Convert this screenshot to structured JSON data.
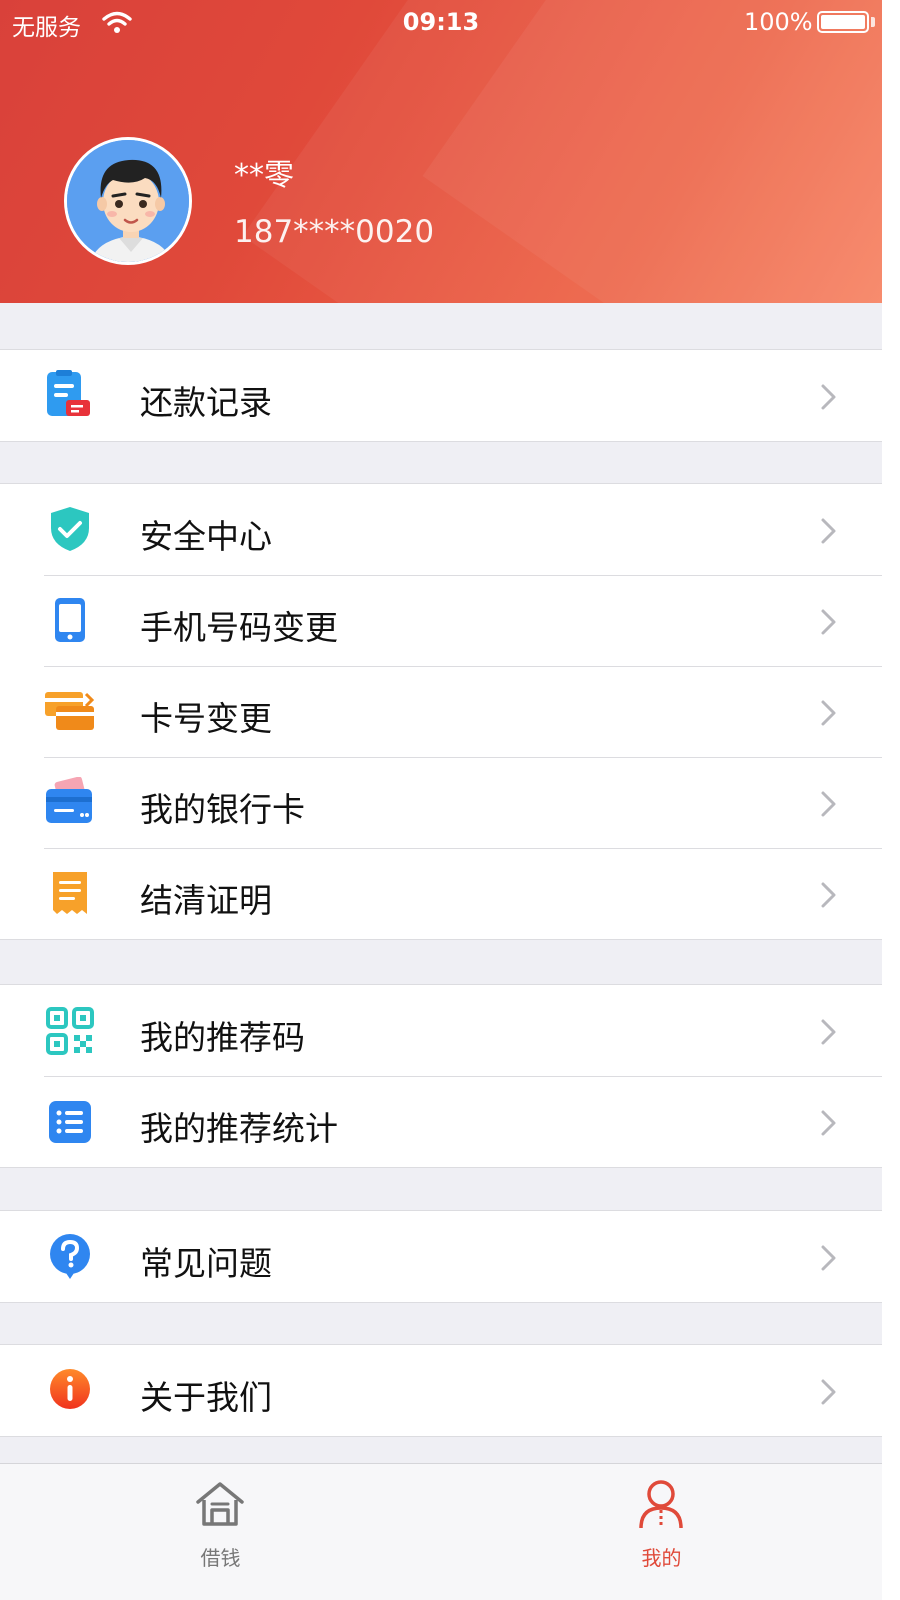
{
  "status_bar": {
    "carrier": "无服务",
    "time": "09:13",
    "battery": "100%"
  },
  "profile": {
    "name": "**零",
    "phone": "187****0020"
  },
  "menu": {
    "repay_record": "还款记录",
    "security_center": "安全中心",
    "phone_change": "手机号码变更",
    "card_change": "卡号变更",
    "my_bank_card": "我的银行卡",
    "settlement_proof": "结清证明",
    "referral_code": "我的推荐码",
    "referral_stats": "我的推荐统计",
    "faq": "常见问题",
    "about_us": "关于我们"
  },
  "tabs": {
    "borrow": "借钱",
    "mine": "我的"
  },
  "colors": {
    "brand": "#e04a3a",
    "header_start": "#d9413a",
    "header_end": "#f7805f"
  }
}
